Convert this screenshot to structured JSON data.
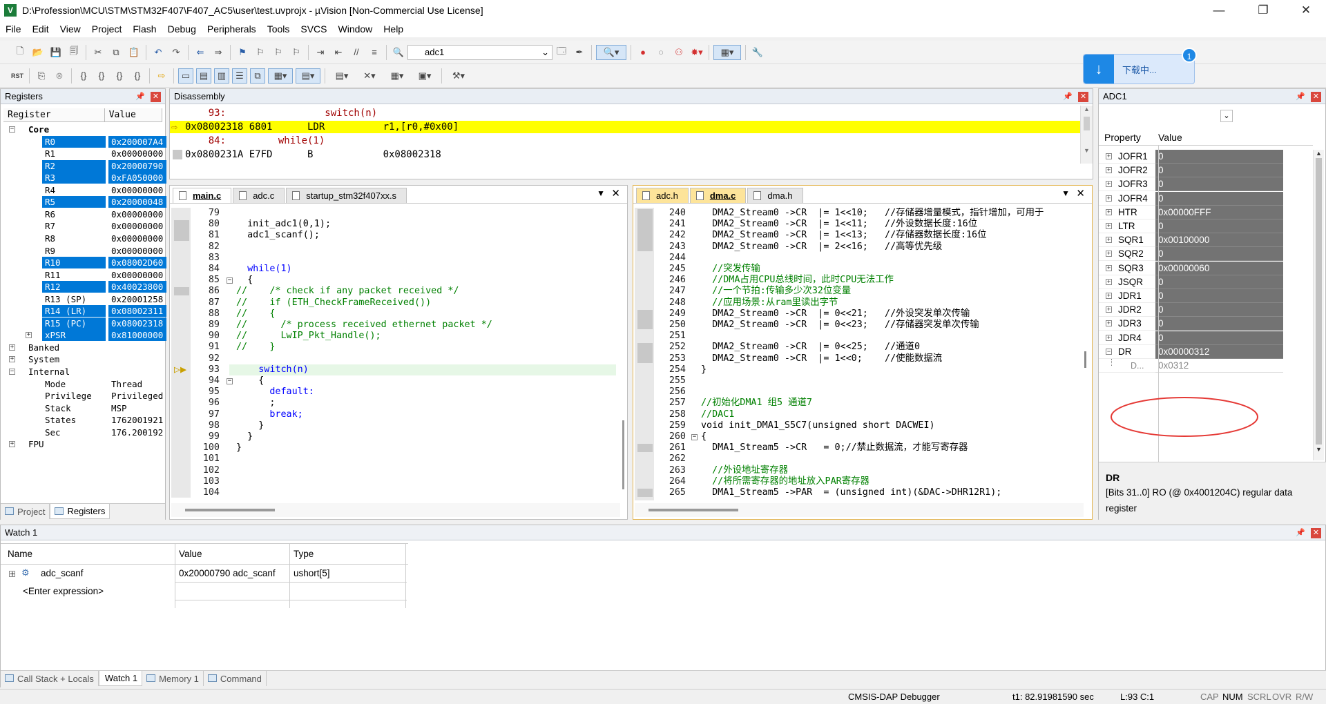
{
  "window": {
    "title": "D:\\Profession\\MCU\\STM\\STM32F407\\F407_AC5\\user\\test.uvprojx - µVision  [Non-Commercial Use License]",
    "minimize": "—",
    "maximize": "❐",
    "close": "✕"
  },
  "menu": [
    "File",
    "Edit",
    "View",
    "Project",
    "Flash",
    "Debug",
    "Peripherals",
    "Tools",
    "SVCS",
    "Window",
    "Help"
  ],
  "toolbar": {
    "target": "adc1"
  },
  "download_badge": {
    "label": "下载中...",
    "count": "1"
  },
  "registers": {
    "title": "Registers",
    "col_register": "Register",
    "col_value": "Value",
    "rows": [
      {
        "name": "Core",
        "value": "",
        "indent": 1,
        "expander": "−",
        "bold": true,
        "sel": false
      },
      {
        "name": "R0",
        "value": "0x200007A4",
        "indent": 3,
        "sel": true
      },
      {
        "name": "R1",
        "value": "0x00000000",
        "indent": 3,
        "sel": false
      },
      {
        "name": "R2",
        "value": "0x20000790",
        "indent": 3,
        "sel": true
      },
      {
        "name": "R3",
        "value": "0xFA050000",
        "indent": 3,
        "sel": true
      },
      {
        "name": "R4",
        "value": "0x00000000",
        "indent": 3,
        "sel": false
      },
      {
        "name": "R5",
        "value": "0x20000048",
        "indent": 3,
        "sel": true
      },
      {
        "name": "R6",
        "value": "0x00000000",
        "indent": 3,
        "sel": false
      },
      {
        "name": "R7",
        "value": "0x00000000",
        "indent": 3,
        "sel": false
      },
      {
        "name": "R8",
        "value": "0x00000000",
        "indent": 3,
        "sel": false
      },
      {
        "name": "R9",
        "value": "0x00000000",
        "indent": 3,
        "sel": false
      },
      {
        "name": "R10",
        "value": "0x08002D60",
        "indent": 3,
        "sel": true
      },
      {
        "name": "R11",
        "value": "0x00000000",
        "indent": 3,
        "sel": false
      },
      {
        "name": "R12",
        "value": "0x40023800",
        "indent": 3,
        "sel": true
      },
      {
        "name": "R13 (SP)",
        "value": "0x20001258",
        "indent": 3,
        "sel": false
      },
      {
        "name": "R14 (LR)",
        "value": "0x08002311",
        "indent": 3,
        "sel": true
      },
      {
        "name": "R15 (PC)",
        "value": "0x08002318",
        "indent": 3,
        "sel": true
      },
      {
        "name": "xPSR",
        "value": "0x81000000",
        "indent": 3,
        "expander": "+",
        "sel": true
      },
      {
        "name": "Banked",
        "value": "",
        "indent": 1,
        "expander": "+",
        "sel": false
      },
      {
        "name": "System",
        "value": "",
        "indent": 1,
        "expander": "+",
        "sel": false
      },
      {
        "name": "Internal",
        "value": "",
        "indent": 1,
        "expander": "−",
        "sel": false
      },
      {
        "name": "Mode",
        "value": "Thread",
        "indent": 3,
        "sel": false
      },
      {
        "name": "Privilege",
        "value": "Privileged",
        "indent": 3,
        "sel": false
      },
      {
        "name": "Stack",
        "value": "MSP",
        "indent": 3,
        "sel": false
      },
      {
        "name": "States",
        "value": "1762001921",
        "indent": 3,
        "sel": false
      },
      {
        "name": "Sec",
        "value": "176.200192",
        "indent": 3,
        "sel": false
      },
      {
        "name": "FPU",
        "value": "",
        "indent": 1,
        "expander": "+",
        "sel": false
      }
    ],
    "tab_project": "Project",
    "tab_registers": "Registers"
  },
  "disassembly": {
    "title": "Disassembly",
    "lines": [
      {
        "text": "    93:                 switch(n)",
        "cls": "src"
      },
      {
        "text": "0x08002318 6801      LDR          r1,[r0,#0x00]",
        "cls": "cur"
      },
      {
        "text": "    84:         while(1)",
        "cls": "src"
      },
      {
        "text": "0x0800231A E7FD      B            0x08002318",
        "cls": "asm"
      }
    ]
  },
  "editor_left": {
    "tabs": [
      "main.c",
      "adc.c",
      "startup_stm32f407xx.s"
    ],
    "active": 0,
    "lines": [
      {
        "n": "79",
        "t": "",
        "c": ""
      },
      {
        "n": "80",
        "t": "  init_adc1(0,1);",
        "c": ""
      },
      {
        "n": "81",
        "t": "  adc1_scanf();",
        "c": ""
      },
      {
        "n": "82",
        "t": "",
        "c": ""
      },
      {
        "n": "83",
        "t": "",
        "c": ""
      },
      {
        "n": "84",
        "t": "  while(1)",
        "c": "kw"
      },
      {
        "n": "85",
        "t": "  {",
        "c": ""
      },
      {
        "n": "86",
        "t": "//    /* check if any packet received */",
        "c": "cm"
      },
      {
        "n": "87",
        "t": "//    if (ETH_CheckFrameReceived())",
        "c": "cm"
      },
      {
        "n": "88",
        "t": "//    {",
        "c": "cm"
      },
      {
        "n": "89",
        "t": "//      /* process received ethernet packet */",
        "c": "cm"
      },
      {
        "n": "90",
        "t": "//      LwIP_Pkt_Handle();",
        "c": "cm"
      },
      {
        "n": "91",
        "t": "//    }",
        "c": "cm"
      },
      {
        "n": "92",
        "t": "",
        "c": ""
      },
      {
        "n": "93",
        "t": "    switch(n)",
        "c": "kw"
      },
      {
        "n": "94",
        "t": "    {",
        "c": ""
      },
      {
        "n": "95",
        "t": "      default:",
        "c": "kw"
      },
      {
        "n": "96",
        "t": "      ;",
        "c": ""
      },
      {
        "n": "97",
        "t": "      break;",
        "c": "kw"
      },
      {
        "n": "98",
        "t": "    }",
        "c": ""
      },
      {
        "n": "99",
        "t": "  }",
        "c": ""
      },
      {
        "n": "100",
        "t": "}",
        "c": ""
      },
      {
        "n": "101",
        "t": "",
        "c": ""
      },
      {
        "n": "102",
        "t": "",
        "c": ""
      },
      {
        "n": "103",
        "t": "",
        "c": ""
      },
      {
        "n": "104",
        "t": "",
        "c": ""
      }
    ]
  },
  "editor_right": {
    "tabs": [
      "adc.h",
      "dma.c",
      "dma.h"
    ],
    "active": 1,
    "lines": [
      {
        "n": "240",
        "t": "  DMA2_Stream0 ->CR  |= 1<<10;   //存储器增量模式，指针增加，可用于",
        "c": "mix"
      },
      {
        "n": "241",
        "t": "  DMA2_Stream0 ->CR  |= 1<<11;   //外设数据长度:16位",
        "c": "mix"
      },
      {
        "n": "242",
        "t": "  DMA2_Stream0 ->CR  |= 1<<13;   //存储器数据长度:16位",
        "c": "mix"
      },
      {
        "n": "243",
        "t": "  DMA2_Stream0 ->CR  |= 2<<16;   //高等优先级",
        "c": "mix"
      },
      {
        "n": "244",
        "t": "",
        "c": ""
      },
      {
        "n": "245",
        "t": "  //突发传输",
        "c": "cm"
      },
      {
        "n": "246",
        "t": "  //DMA占用CPU总线时间，此时CPU无法工作",
        "c": "cm"
      },
      {
        "n": "247",
        "t": "  //一个节拍:传输多少次32位变量",
        "c": "cm"
      },
      {
        "n": "248",
        "t": "  //应用场景:从ram里读出字节",
        "c": "cm"
      },
      {
        "n": "249",
        "t": "  DMA2_Stream0 ->CR  |= 0<<21;   //外设突发单次传输",
        "c": "mix"
      },
      {
        "n": "250",
        "t": "  DMA2_Stream0 ->CR  |= 0<<23;   //存储器突发单次传输",
        "c": "mix"
      },
      {
        "n": "251",
        "t": "",
        "c": ""
      },
      {
        "n": "252",
        "t": "  DMA2_Stream0 ->CR  |= 0<<25;   //通道0",
        "c": "mix"
      },
      {
        "n": "253",
        "t": "  DMA2_Stream0 ->CR  |= 1<<0;    //使能数据流",
        "c": "mix"
      },
      {
        "n": "254",
        "t": "}",
        "c": ""
      },
      {
        "n": "255",
        "t": "",
        "c": ""
      },
      {
        "n": "256",
        "t": "",
        "c": ""
      },
      {
        "n": "257",
        "t": "//初始化DMA1 组5 通道7",
        "c": "cm"
      },
      {
        "n": "258",
        "t": "//DAC1",
        "c": "cm"
      },
      {
        "n": "259",
        "t": "void init_DMA1_S5C7(unsigned short DACWEI)",
        "c": "fn"
      },
      {
        "n": "260",
        "t": "{",
        "c": ""
      },
      {
        "n": "261",
        "t": "  DMA1_Stream5 ->CR   = 0;//禁止数据流，才能写寄存器",
        "c": "mix"
      },
      {
        "n": "262",
        "t": "",
        "c": ""
      },
      {
        "n": "263",
        "t": "  //外设地址寄存器",
        "c": "cm"
      },
      {
        "n": "264",
        "t": "  //将所需寄存器的地址放入PAR寄存器",
        "c": "cm"
      },
      {
        "n": "265",
        "t": "  DMA1_Stream5 ->PAR  = (unsigned int)(&DAC->DHR12R1);",
        "c": "par"
      }
    ]
  },
  "adc1": {
    "title": "ADC1",
    "col_property": "Property",
    "col_value": "Value",
    "rows": [
      {
        "name": "JOFR1",
        "value": "0",
        "exp": "+"
      },
      {
        "name": "JOFR2",
        "value": "0",
        "exp": "+"
      },
      {
        "name": "JOFR3",
        "value": "0",
        "exp": "+"
      },
      {
        "name": "JOFR4",
        "value": "0",
        "exp": "+"
      },
      {
        "name": "HTR",
        "value": "0x00000FFF",
        "exp": "+"
      },
      {
        "name": "LTR",
        "value": "0",
        "exp": "+"
      },
      {
        "name": "SQR1",
        "value": "0x00100000",
        "exp": "+"
      },
      {
        "name": "SQR2",
        "value": "0",
        "exp": "+"
      },
      {
        "name": "SQR3",
        "value": "0x00000060",
        "exp": "+"
      },
      {
        "name": "JSQR",
        "value": "0",
        "exp": "+"
      },
      {
        "name": "JDR1",
        "value": "0",
        "exp": "+"
      },
      {
        "name": "JDR2",
        "value": "0",
        "exp": "+"
      },
      {
        "name": "JDR3",
        "value": "0",
        "exp": "+"
      },
      {
        "name": "JDR4",
        "value": "0",
        "exp": "+"
      },
      {
        "name": "DR",
        "value": "0x00000312",
        "exp": "−"
      }
    ],
    "subrow": {
      "name": "D...",
      "value": "0x0312"
    },
    "desc_title": "DR",
    "desc_text": "[Bits 31..0] RO (@ 0x4001204C) regular data register"
  },
  "watch": {
    "title": "Watch 1",
    "col_name": "Name",
    "col_value": "Value",
    "col_type": "Type",
    "row1": {
      "name": "adc_scanf",
      "value": "0x20000790 adc_scanf",
      "type": "ushort[5]"
    },
    "row2": "<Enter expression>",
    "tabs": [
      "Call Stack + Locals",
      "Watch 1",
      "Memory 1",
      "Command"
    ]
  },
  "status": {
    "debugger": "CMSIS-DAP Debugger",
    "time": "t1: 82.91981590 sec",
    "pos": "L:93 C:1",
    "cap": "CAP",
    "num": "NUM",
    "scrl": "SCRL",
    "ovr": "OVR",
    "rw": "R/W"
  },
  "colors": {
    "selection": "#0078d7",
    "current_line": "#ffff00",
    "keyword": "#0000ff",
    "comment": "#008000",
    "highlight_circle": "#e53935"
  }
}
